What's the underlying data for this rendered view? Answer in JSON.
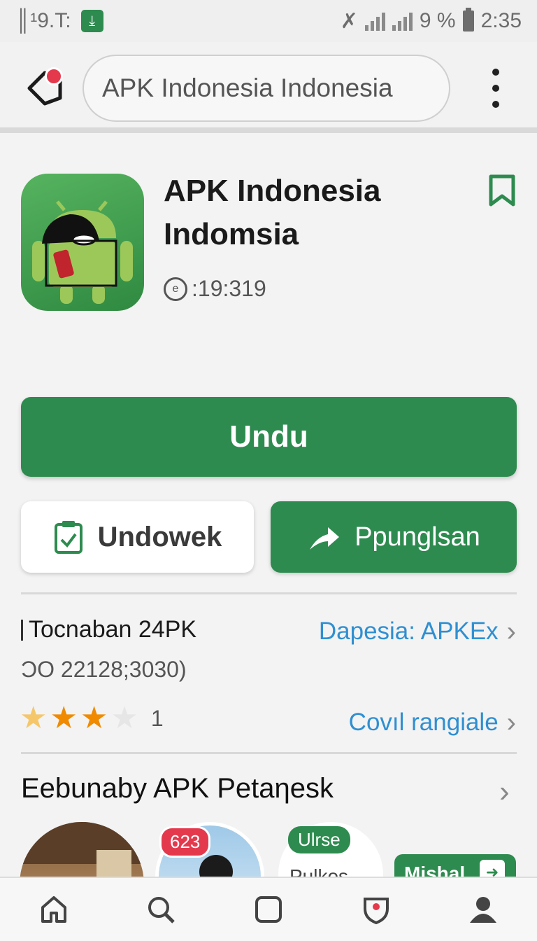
{
  "status_bar": {
    "left_text": "║¹9.T:",
    "right_text": "9 %",
    "time": "2:35",
    "icons": [
      "download-notification-icon",
      "tools-icon",
      "signal-icon",
      "battery-icon"
    ]
  },
  "browser": {
    "url": "APK Indonesia  Indonesia",
    "notification_color": "#e4394d"
  },
  "app": {
    "title": "APK Indonesia Indomsia",
    "meta": ":19:319",
    "icon_name": "android-app-icon"
  },
  "buttons": {
    "primary": "Undu",
    "secondary": "Undowek",
    "tertiary": "Ppunglsan"
  },
  "info": {
    "row1_left": "Tocnaban 24PK",
    "row1_right": "Dapesia: APKEx",
    "row2_left": "ƆO 22128;3030)",
    "rating": {
      "stars_filled": 3,
      "stars_total": 4,
      "count": "1"
    },
    "rating_link": "Covıl rangiale"
  },
  "section": {
    "title": "Eebunaby APK Petaηesk",
    "badges": {
      "count": "623",
      "green": "Ulrse",
      "partial": "Pulkos",
      "action": "Mishal"
    }
  },
  "colors": {
    "accent": "#2e8b4f",
    "link": "#2f8fd1",
    "star": "#f08a00",
    "star_light": "#f5c76a",
    "star_empty": "#e6e6e6"
  },
  "bottom_nav": [
    "home-icon",
    "search-icon",
    "tabs-icon",
    "shield-icon",
    "profile-icon"
  ]
}
